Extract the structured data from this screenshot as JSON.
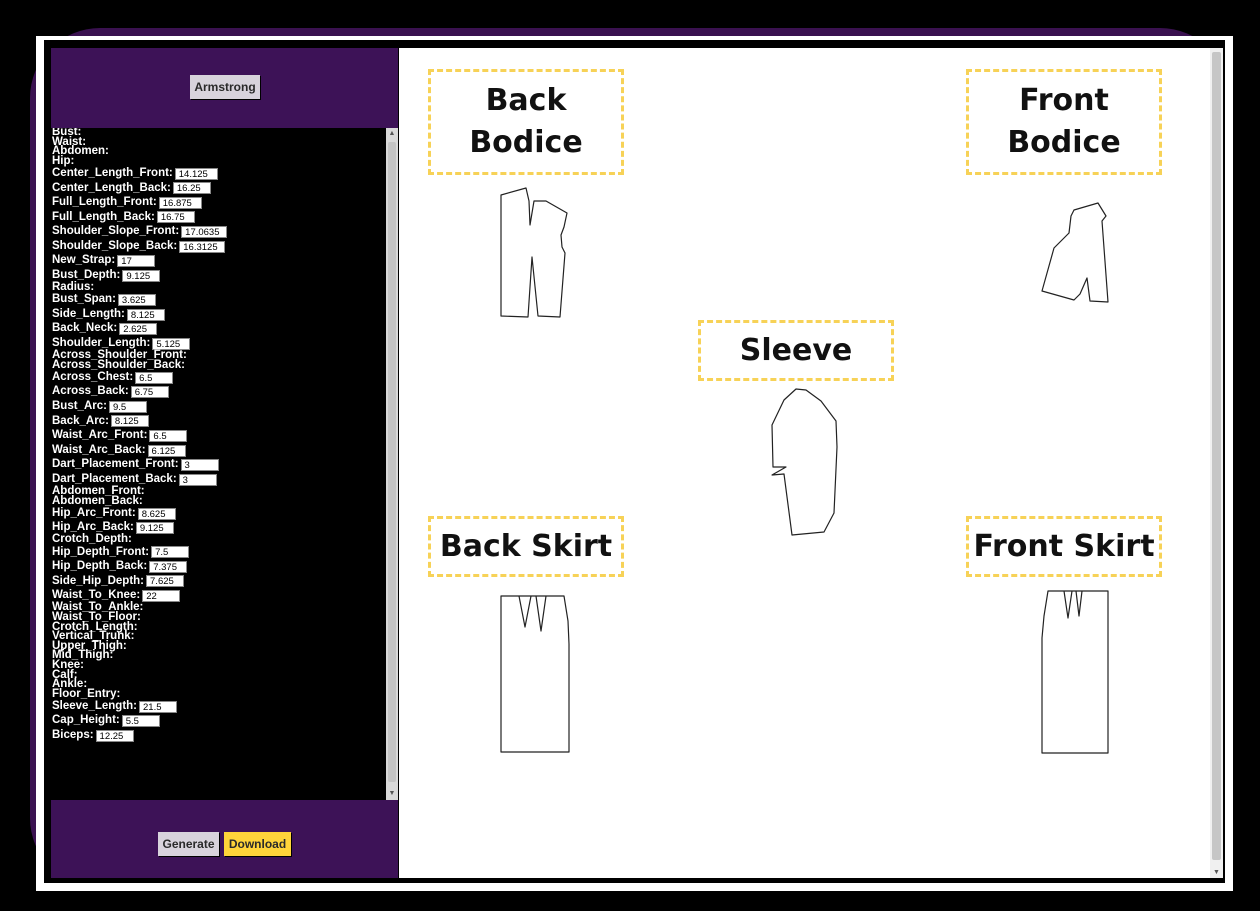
{
  "sidebar": {
    "system_button": "Armstrong",
    "generate_button": "Generate",
    "download_button": "Download",
    "measurements": [
      {
        "label": "Bust:",
        "value": null
      },
      {
        "label": "Waist:",
        "value": null
      },
      {
        "label": "Abdomen:",
        "value": null
      },
      {
        "label": "Hip:",
        "value": null
      },
      {
        "label": "Center_Length_Front:",
        "value": "14.125"
      },
      {
        "label": "Center_Length_Back:",
        "value": "16.25"
      },
      {
        "label": "Full_Length_Front:",
        "value": "16.875"
      },
      {
        "label": "Full_Length_Back:",
        "value": "16.75"
      },
      {
        "label": "Shoulder_Slope_Front:",
        "value": "17.0635"
      },
      {
        "label": "Shoulder_Slope_Back:",
        "value": "16.3125"
      },
      {
        "label": "New_Strap:",
        "value": "17"
      },
      {
        "label": "Bust_Depth:",
        "value": "9.125"
      },
      {
        "label": "Radius:",
        "value": null
      },
      {
        "label": "Bust_Span:",
        "value": "3.625"
      },
      {
        "label": "Side_Length:",
        "value": "8.125"
      },
      {
        "label": "Back_Neck:",
        "value": "2.625"
      },
      {
        "label": "Shoulder_Length:",
        "value": "5.125"
      },
      {
        "label": "Across_Shoulder_Front:",
        "value": null
      },
      {
        "label": "Across_Shoulder_Back:",
        "value": null
      },
      {
        "label": "Across_Chest:",
        "value": "6.5"
      },
      {
        "label": "Across_Back:",
        "value": "6.75"
      },
      {
        "label": "Bust_Arc:",
        "value": "9.5"
      },
      {
        "label": "Back_Arc:",
        "value": "8.125"
      },
      {
        "label": "Waist_Arc_Front:",
        "value": "6.5"
      },
      {
        "label": "Waist_Arc_Back:",
        "value": "6.125"
      },
      {
        "label": "Dart_Placement_Front:",
        "value": "3"
      },
      {
        "label": "Dart_Placement_Back:",
        "value": "3"
      },
      {
        "label": "Abdomen_Front:",
        "value": null
      },
      {
        "label": "Abdomen_Back:",
        "value": null
      },
      {
        "label": "Hip_Arc_Front:",
        "value": "8.625"
      },
      {
        "label": "Hip_Arc_Back:",
        "value": "9.125"
      },
      {
        "label": "Crotch_Depth:",
        "value": null
      },
      {
        "label": "Hip_Depth_Front:",
        "value": "7.5"
      },
      {
        "label": "Hip_Depth_Back:",
        "value": "7.375"
      },
      {
        "label": "Side_Hip_Depth:",
        "value": "7.625"
      },
      {
        "label": "Waist_To_Knee:",
        "value": "22"
      },
      {
        "label": "Waist_To_Ankle:",
        "value": null
      },
      {
        "label": "Waist_To_Floor:",
        "value": null
      },
      {
        "label": "Crotch_Length:",
        "value": null
      },
      {
        "label": "Vertical_Trunk:",
        "value": null
      },
      {
        "label": "Upper_Thigh:",
        "value": null
      },
      {
        "label": "Mid_Thigh:",
        "value": null
      },
      {
        "label": "Knee:",
        "value": null
      },
      {
        "label": "Calf:",
        "value": null
      },
      {
        "label": "Ankle:",
        "value": null
      },
      {
        "label": "Floor_Entry:",
        "value": null
      },
      {
        "label": "Sleeve_Length:",
        "value": "21.5"
      },
      {
        "label": "Cap_Height:",
        "value": "5.5"
      },
      {
        "label": "Biceps:",
        "value": "12.25"
      }
    ]
  },
  "canvas": {
    "pieces": {
      "back_bodice": "Back Bodice",
      "front_bodice": "Front Bodice",
      "sleeve": "Sleeve",
      "back_skirt": "Back Skirt",
      "front_skirt": "Front Skirt"
    }
  },
  "colors": {
    "frame_purple": "#3d1257",
    "label_border": "#f7d257",
    "download_yellow": "#ffd43a"
  }
}
